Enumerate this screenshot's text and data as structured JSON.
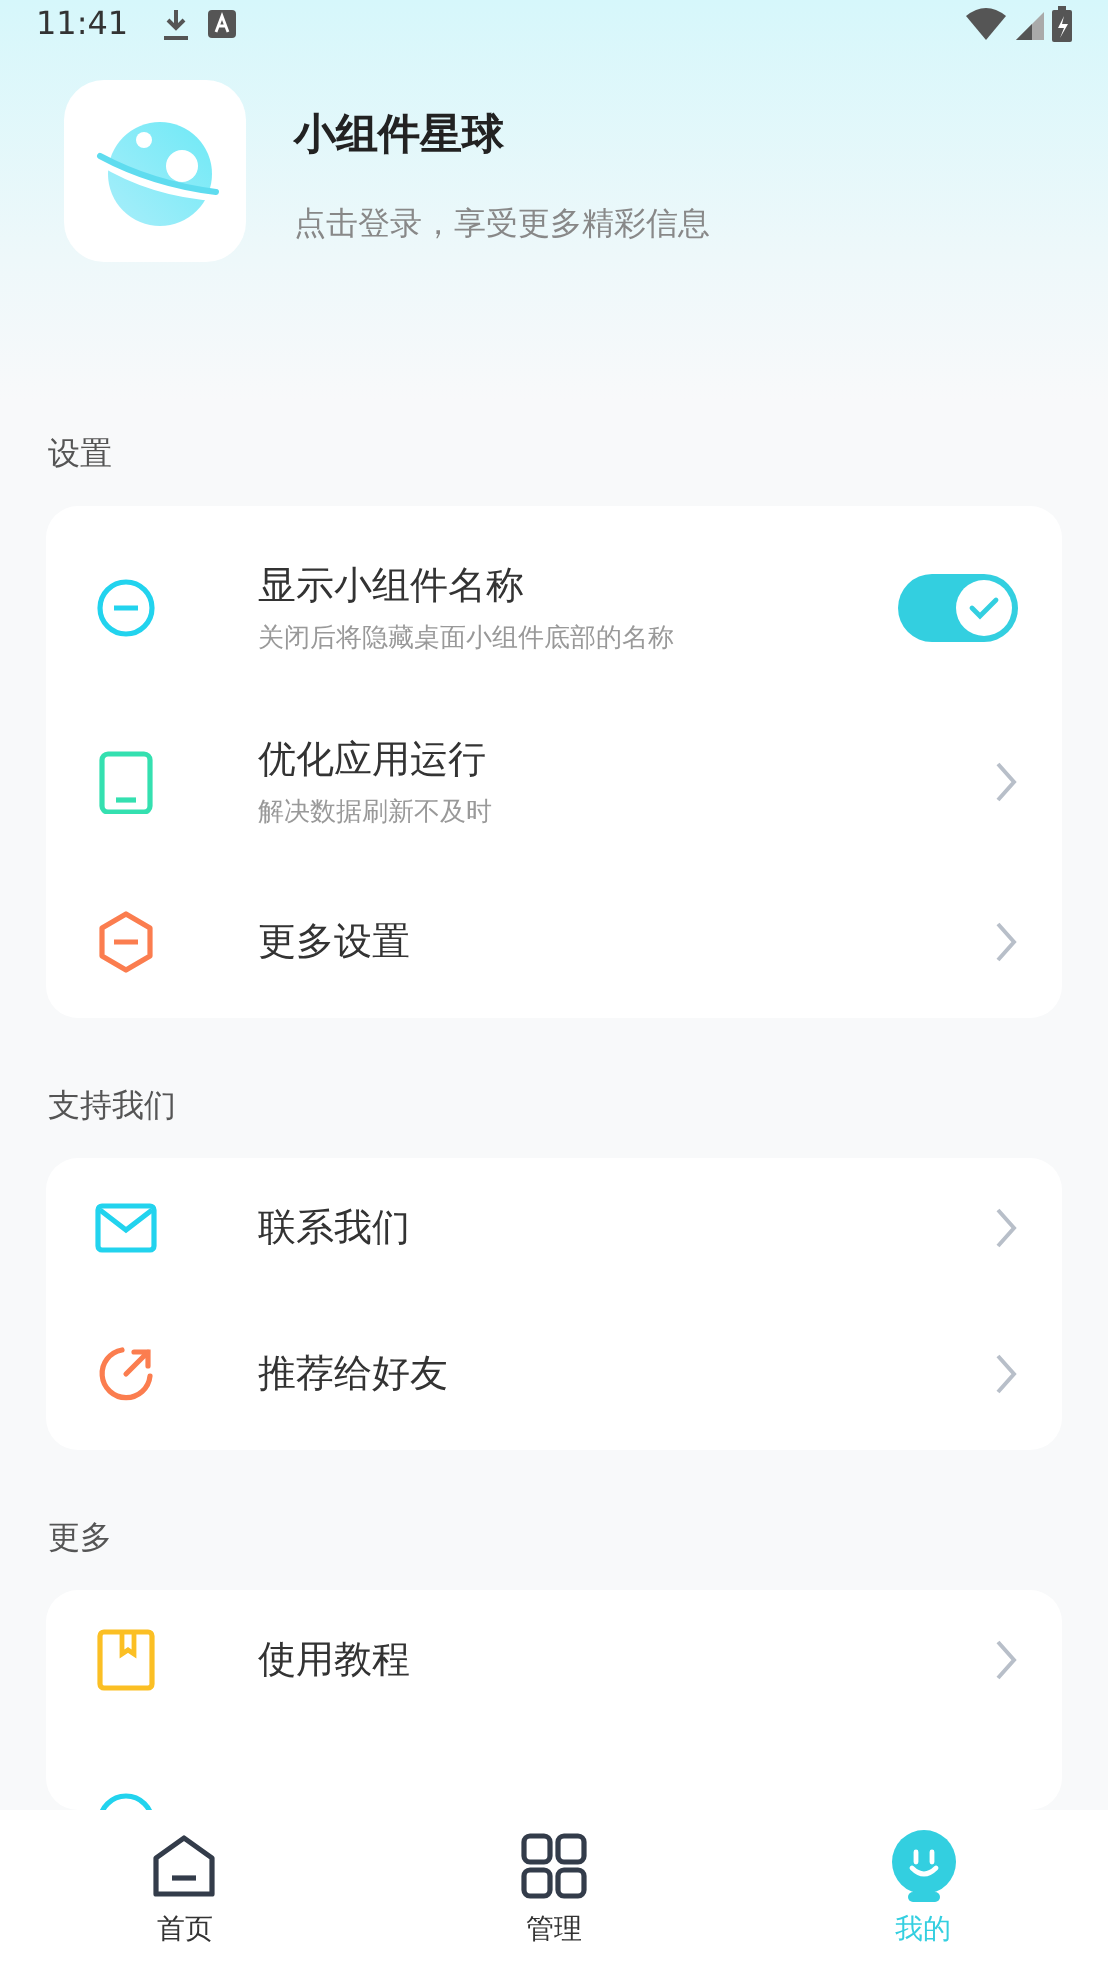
{
  "status_bar": {
    "time": "11:41"
  },
  "profile": {
    "title": "小组件星球",
    "subtitle": "点击登录，享受更多精彩信息"
  },
  "sections": [
    {
      "title": "设置",
      "items": [
        {
          "kind": "toggle",
          "label": "显示小组件名称",
          "description": "关闭后将隐藏桌面小组件底部的名称",
          "on": true
        },
        {
          "kind": "link",
          "label": "优化应用运行",
          "description": "解决数据刷新不及时"
        },
        {
          "kind": "link",
          "label": "更多设置"
        }
      ]
    },
    {
      "title": "支持我们",
      "items": [
        {
          "kind": "link",
          "label": "联系我们"
        },
        {
          "kind": "link",
          "label": "推荐给好友"
        }
      ]
    },
    {
      "title": "更多",
      "items": [
        {
          "kind": "link",
          "label": "使用教程"
        },
        {
          "kind": "hidden"
        }
      ]
    }
  ],
  "tabs": [
    {
      "label": "首页",
      "selected": false
    },
    {
      "label": "管理",
      "selected": false
    },
    {
      "label": "我的",
      "selected": true
    }
  ]
}
